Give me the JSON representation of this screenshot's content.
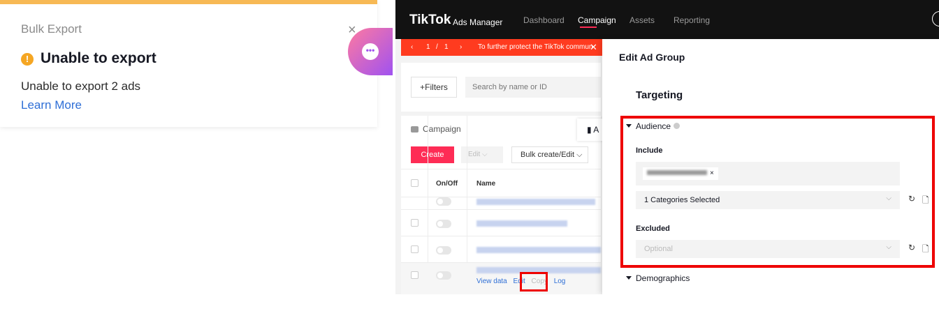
{
  "export_popup": {
    "title": "Bulk Export",
    "close_icon": "×",
    "heading": "Unable to export",
    "message": "Unable to export 2 ads",
    "link": "Learn More",
    "warn_icon": "!",
    "chat_icon": "•••",
    "accent_color": "#f7b955"
  },
  "ads_manager": {
    "logo": "TikTok",
    "logo_sub": "Ads Manager",
    "nav": [
      "Dashboard",
      "Campaign",
      "Assets",
      "Reporting"
    ],
    "notice": {
      "prev": "‹",
      "page": "1",
      "sep": "/",
      "total": "1",
      "next": "›",
      "text": "To further protect the TikTok commun",
      "close": "✕"
    },
    "filters_label": "+Filters",
    "search_placeholder": "Search by name or ID",
    "tabs": {
      "campaign": "Campaign",
      "adgroup_glyph": "▮ A"
    },
    "toolbar": {
      "create": "Create",
      "edit": "Edit ⌵",
      "bulk": "Bulk create/Edit ⌵"
    },
    "table": {
      "headers": [
        "On/Off",
        "Name"
      ],
      "row_actions": [
        "View data",
        "Edit",
        "Copy",
        "Log"
      ]
    },
    "edit_panel": {
      "title": "Edit Ad Group",
      "section": "Targeting",
      "audience_label": "Audience",
      "include_label": "Include",
      "include_tag_close": "×",
      "include_select": "1 Categories Selected",
      "excluded_label": "Excluded",
      "excluded_placeholder": "Optional",
      "demographics_label": "Demographics",
      "chevron": "⌵",
      "refresh_icon": "↻",
      "doc_icon": "🗋"
    },
    "highlight_color": "#ee0000",
    "brand_color": "#fe2c55"
  }
}
